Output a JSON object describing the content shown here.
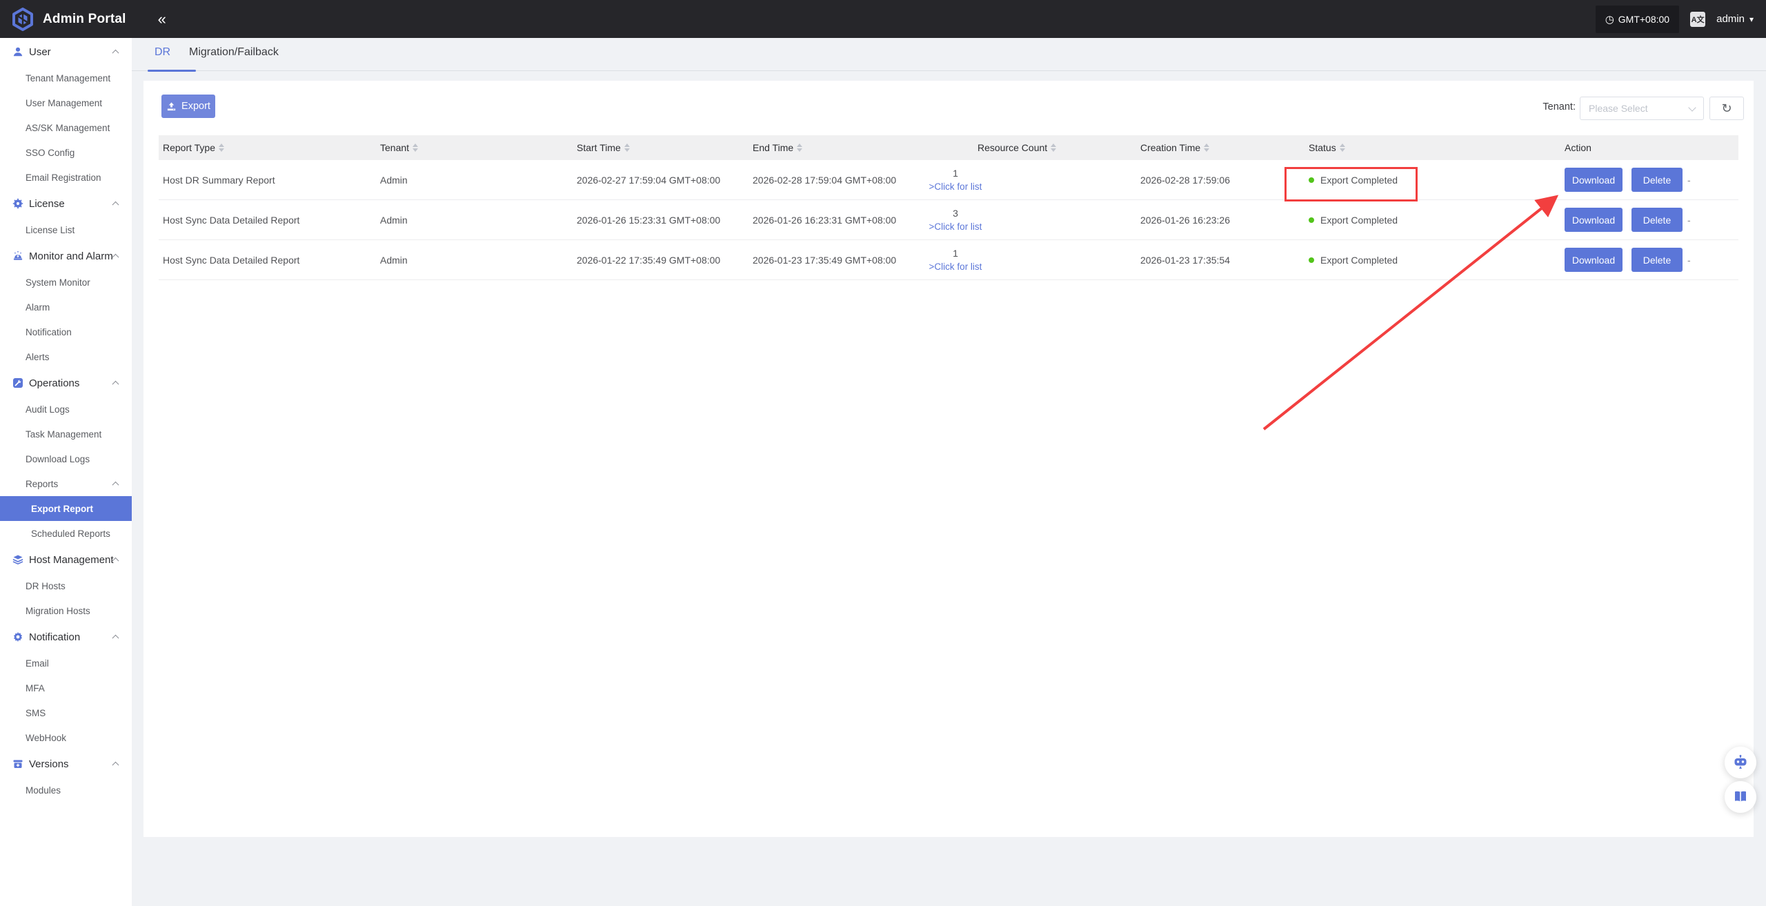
{
  "colors": {
    "primary": "#5b76d8",
    "export_button": "#7186dc",
    "status_green": "#52c41a",
    "annotation_red": "#f23f3f",
    "topbar_bg": "#26262a"
  },
  "topbar": {
    "title": "Admin Portal",
    "collapse_icon": "«",
    "clock_icon": "◷",
    "timezone": "GMT+08:00",
    "language_icon_glyph": "A文",
    "username": "admin",
    "caret_icon": "▾"
  },
  "sidebar": {
    "items": [
      {
        "label": "User"
      },
      {
        "label": "Tenant Management"
      },
      {
        "label": "User Management"
      },
      {
        "label": "AS/SK Management"
      },
      {
        "label": "SSO Config"
      },
      {
        "label": "Email Registration"
      },
      {
        "label": "License"
      },
      {
        "label": "License List"
      },
      {
        "label": "Monitor and Alarm"
      },
      {
        "label": "System Monitor"
      },
      {
        "label": "Alarm"
      },
      {
        "label": "Notification"
      },
      {
        "label": "Alerts"
      },
      {
        "label": "Operations"
      },
      {
        "label": "Audit Logs"
      },
      {
        "label": "Task Management"
      },
      {
        "label": "Download Logs"
      },
      {
        "label": "Reports"
      },
      {
        "label": "Export Report"
      },
      {
        "label": "Scheduled Reports"
      },
      {
        "label": "Host Management"
      },
      {
        "label": "DR Hosts"
      },
      {
        "label": "Migration Hosts"
      },
      {
        "label": "Notification"
      },
      {
        "label": "Email"
      },
      {
        "label": "MFA"
      },
      {
        "label": "SMS"
      },
      {
        "label": "WebHook"
      },
      {
        "label": "Versions"
      },
      {
        "label": "Modules"
      }
    ]
  },
  "tabs": {
    "dr": "DR",
    "migration_failback": "Migration/Failback"
  },
  "toolbar": {
    "export_label": "Export",
    "tenant_label": "Tenant:",
    "tenant_placeholder": "Please Select",
    "refresh_icon": "↻"
  },
  "table": {
    "headers": {
      "report_type": "Report Type",
      "tenant": "Tenant",
      "start_time": "Start Time",
      "end_time": "End Time",
      "resource_count": "Resource Count",
      "creation_time": "Creation Time",
      "status": "Status",
      "action": "Action"
    },
    "download_label": "Download",
    "delete_label": "Delete",
    "more_dash": "-",
    "rows": [
      {
        "report_type": "Host DR Summary Report",
        "tenant": "Admin",
        "start_time": "2026-02-27 17:59:04 GMT+08:00",
        "end_time": "2026-02-28 17:59:04 GMT+08:00",
        "resource_count": "1",
        "resource_link": ">Click for list",
        "creation_time": "2026-02-28 17:59:06",
        "status": "Export Completed"
      },
      {
        "report_type": "Host Sync Data Detailed Report",
        "tenant": "Admin",
        "start_time": "2026-01-26 15:23:31 GMT+08:00",
        "end_time": "2026-01-26 16:23:31 GMT+08:00",
        "resource_count": "3",
        "resource_link": ">Click for list",
        "creation_time": "2026-01-26 16:23:26",
        "status": "Export Completed"
      },
      {
        "report_type": "Host Sync Data Detailed Report",
        "tenant": "Admin",
        "start_time": "2026-01-22 17:35:49 GMT+08:00",
        "end_time": "2026-01-23 17:35:49 GMT+08:00",
        "resource_count": "1",
        "resource_link": ">Click for list",
        "creation_time": "2026-01-23 17:35:54",
        "status": "Export Completed"
      }
    ]
  },
  "icons": {
    "logo": "cube-logo",
    "sidebar": [
      "user-icon",
      "license-icon",
      "alarm-icon",
      "operations-icon",
      "layers-icon",
      "gear-icon",
      "versions-icon"
    ],
    "floating": [
      "robot-assistant-icon",
      "manual-book-icon"
    ]
  }
}
